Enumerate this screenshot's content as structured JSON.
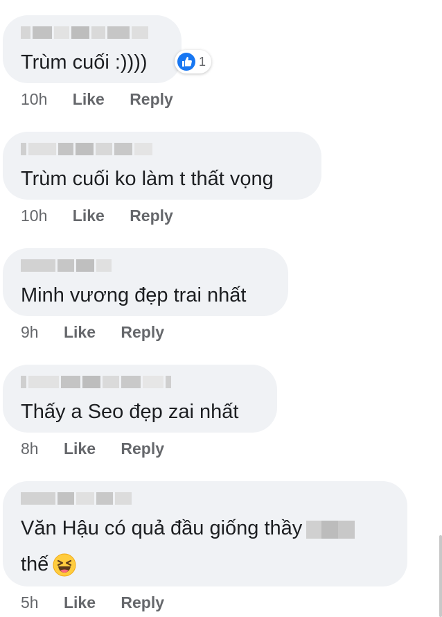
{
  "comments": [
    {
      "text": "Trùm cuối :))))",
      "time": "10h",
      "like": "Like",
      "reply": "Reply",
      "reaction_count": "1",
      "reaction_icon": "like-icon"
    },
    {
      "text": "Trùm cuối ko làm t thất vọng",
      "time": "10h",
      "like": "Like",
      "reply": "Reply"
    },
    {
      "text": "Minh vương đẹp trai nhất",
      "time": "9h",
      "like": "Like",
      "reply": "Reply"
    },
    {
      "text": "Thấy a Seo đẹp zai nhất",
      "time": "8h",
      "like": "Like",
      "reply": "Reply"
    },
    {
      "text_line1": "Văn Hậu có quả đầu giống thầy",
      "text_line2": "thế",
      "time": "5h",
      "like": "Like",
      "reply": "Reply",
      "emoji": "grinning-squinting-face"
    }
  ],
  "colors": {
    "bubble": "#f0f2f5",
    "text": "#1c1e21",
    "meta": "#65676b",
    "like_blue": "#1877f2"
  }
}
